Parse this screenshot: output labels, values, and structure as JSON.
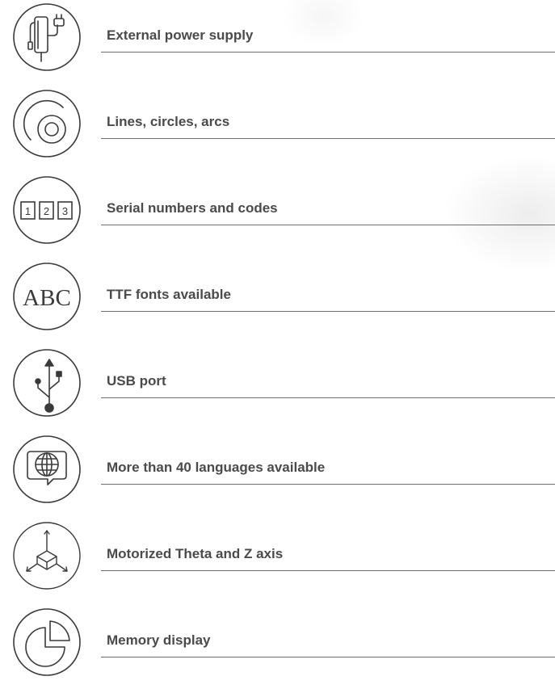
{
  "features": [
    {
      "label": "External power supply",
      "icon": "power-adapter-icon"
    },
    {
      "label": "Lines, circles, arcs",
      "icon": "circles-arcs-icon"
    },
    {
      "label": "Serial numbers and codes",
      "icon": "serial-numbers-icon"
    },
    {
      "label": "TTF fonts available",
      "icon": "ttf-fonts-icon"
    },
    {
      "label": "USB port",
      "icon": "usb-icon"
    },
    {
      "label": "More than 40 languages available",
      "icon": "languages-globe-icon"
    },
    {
      "label": "Motorized Theta and Z axis",
      "icon": "axis-icon"
    },
    {
      "label": "Memory display",
      "icon": "pie-chart-icon"
    }
  ],
  "icon_text": {
    "serial": [
      "1",
      "2",
      "3"
    ],
    "abc": "ABC"
  },
  "colors": {
    "icon_stroke": "#3a3a3a",
    "label_text": "#4a4a4a",
    "rule": "#6e6e6e"
  }
}
